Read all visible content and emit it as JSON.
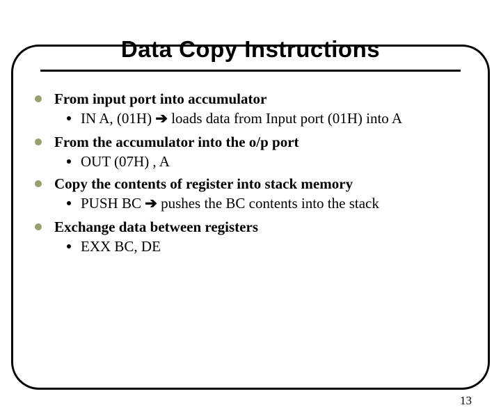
{
  "title": "Data Copy Instructions",
  "items": [
    {
      "head": "From input port into accumulator",
      "sub_pre": "IN A, (01H) ",
      "sub_post": " loads data from Input port (01H) into A"
    },
    {
      "head": "From the accumulator into the o/p port",
      "sub_pre": "OUT (07H) , A",
      "sub_post": ""
    },
    {
      "head": "Copy the contents of register into stack memory",
      "sub_pre": "PUSH BC  ",
      "sub_post": " pushes the BC contents into the stack"
    },
    {
      "head": "Exchange data between registers",
      "sub_pre": "EXX  BC, DE",
      "sub_post": ""
    }
  ],
  "arrow": "➔",
  "page_number": "13"
}
